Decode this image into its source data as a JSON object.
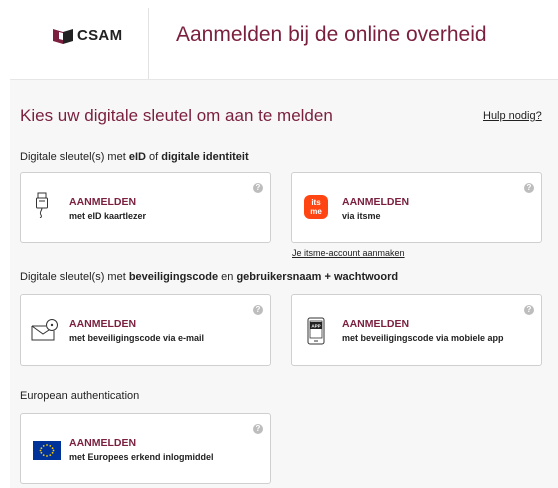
{
  "header": {
    "logo_text": "CSAM",
    "title": "Aanmelden bij de online overheid"
  },
  "main": {
    "title": "Kies uw digitale sleutel om aan te melden",
    "help_link": "Hulp nodig?"
  },
  "sections": [
    {
      "prefix": "Digitale sleutel(s) met ",
      "bold1": "eID",
      "mid": " of ",
      "bold2": "digitale identiteit",
      "mid2": "",
      "bold3": ""
    },
    {
      "prefix": "Digitale sleutel(s) met ",
      "bold1": "beveiligingscode",
      "mid": " en ",
      "bold2": "gebruikersnaam + wachtwoord",
      "mid2": "",
      "bold3": ""
    },
    {
      "text": "European authentication"
    }
  ],
  "cards": {
    "eid": {
      "title": "AANMELDEN",
      "sub": "met eID kaartlezer",
      "help": "?"
    },
    "itsme": {
      "title": "AANMELDEN",
      "sub": "via itsme",
      "help": "?",
      "logo_top": "its",
      "logo_bottom": "me"
    },
    "email": {
      "title": "AANMELDEN",
      "sub": "met beveiligingscode via e-mail",
      "help": "?"
    },
    "app": {
      "title": "AANMELDEN",
      "sub": "met beveiligingscode via mobiele app",
      "help": "?",
      "badge": "APP"
    },
    "eu": {
      "title": "AANMELDEN",
      "sub": "met Europees erkend inlogmiddel",
      "help": "?"
    }
  },
  "itsme_create_link": "Je itsme-account aanmaken",
  "colors": {
    "accent": "#7a1f3d",
    "itsme": "#ff4612",
    "eu_blue": "#003399",
    "eu_stars": "#ffcc00"
  }
}
